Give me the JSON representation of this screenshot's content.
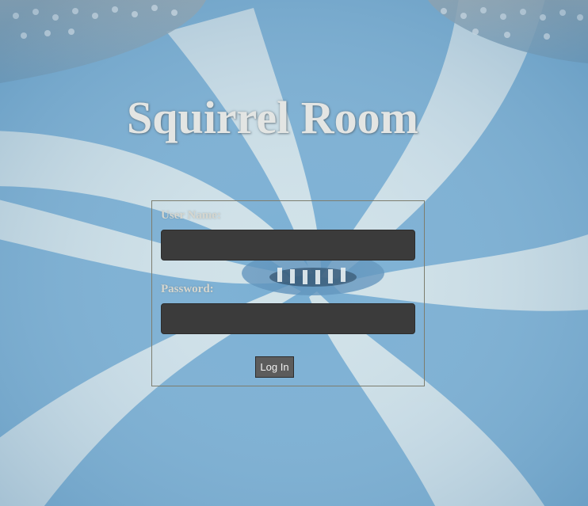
{
  "page": {
    "title": "Squirrel Room"
  },
  "login": {
    "username_label": "User Name:",
    "username_value": "",
    "password_label": "Password:",
    "password_value": "",
    "submit_label": "Log In"
  },
  "theme": {
    "field_bg": "#3b3b3b",
    "label_color": "#d5d6cf",
    "title_color": "#e3e5e3",
    "swirl_blue": "#6fa6cf",
    "swirl_white": "#cfe2ea"
  }
}
